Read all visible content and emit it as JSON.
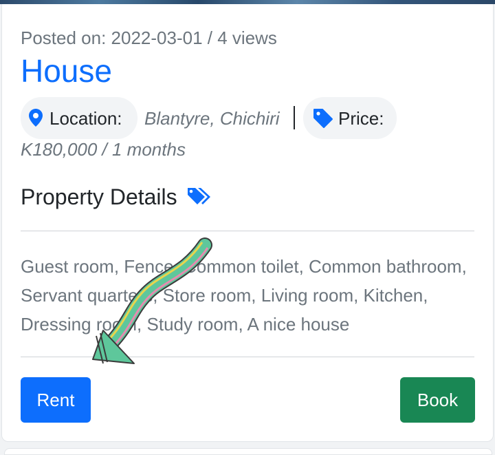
{
  "listing": {
    "posted_text": "Posted on: 2022-03-01 / 4 views",
    "title": "House",
    "location_label": "Location:",
    "location_value": "Blantyre, Chichiri",
    "price_label": "Price:",
    "price_value": "K180,000 / 1 months",
    "details_heading": "Property Details",
    "description": "Guest room, Fence, Common toilet, Common bathroom, Servant quarters, Store room, Living room, Kitchen, Dressing room, Study room, A nice house"
  },
  "actions": {
    "rent_label": "Rent",
    "book_label": "Book"
  },
  "colors": {
    "primary": "#0d6efd",
    "success": "#198754",
    "muted": "#6c757d",
    "annotation_arrow_fill": "#5ec79b",
    "annotation_arrow_stripes": [
      "#e8d44d",
      "#e58bb0"
    ]
  },
  "icons": {
    "location": "map-pin-icon",
    "price": "price-tag-icon",
    "details": "double-tags-icon"
  }
}
